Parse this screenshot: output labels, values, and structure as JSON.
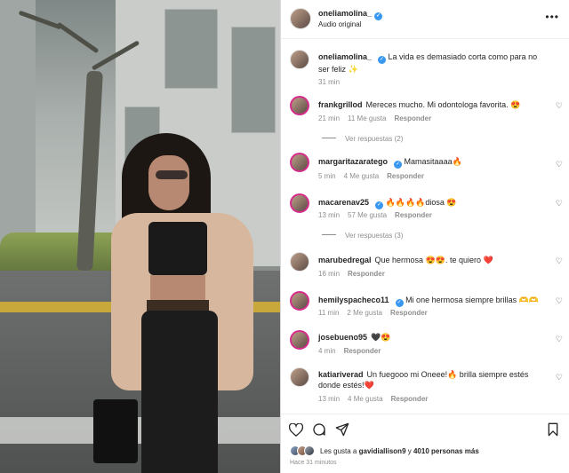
{
  "header": {
    "username": "oneliamolina_",
    "subtitle": "Audio original"
  },
  "caption": {
    "username": "oneliamolina_",
    "text": "La vida es demasiado corta como para no ser feliz ✨",
    "time": "31 min"
  },
  "comments": [
    {
      "username": "frankgrillod",
      "text": "Mereces mucho. Mi odontologa favorita. 😍",
      "time": "21 min",
      "likes": "11 Me gusta",
      "reply": "Responder",
      "view_replies": "Ver respuestas (2)"
    },
    {
      "username": "margaritazaratego",
      "text": "Mamasitaaaa🔥",
      "time": "5 min",
      "likes": "4 Me gusta",
      "reply": "Responder"
    },
    {
      "username": "macarenav25",
      "text": "🔥🔥🔥🔥diosa 😍",
      "time": "13 min",
      "likes": "57 Me gusta",
      "reply": "Responder",
      "view_replies": "Ver respuestas (3)"
    },
    {
      "username": "marubedregal",
      "text": "Que hermosa 😍😍. te quiero ❤️",
      "time": "16 min",
      "reply": "Responder"
    },
    {
      "username": "hemilyspacheco11",
      "text": "Mi one hermosa siempre brillas 🫶🫶",
      "time": "11 min",
      "likes": "2 Me gusta",
      "reply": "Responder"
    },
    {
      "username": "josebueno95",
      "text": "🖤😍",
      "time": "4 min",
      "reply": "Responder"
    },
    {
      "username": "katiariverad",
      "text": "Un fuegooo mi Oneee!🔥 brilla siempre estés donde estés!❤️",
      "time": "13 min",
      "likes": "4 Me gusta",
      "reply": "Responder"
    }
  ],
  "actions": {
    "likes_prefix": "Les gusta a",
    "liked_by": "gavidiallison9",
    "joiner": "y",
    "others": "4010 personas más",
    "posted_ago": "Hace 31 minutos"
  },
  "icons": [
    "more-icon",
    "heart-icon",
    "comment-icon",
    "share-icon",
    "bookmark-icon",
    "verified-icon"
  ],
  "colors": {
    "verified": "#3897f0",
    "story_ring": "#d52c8c",
    "secondary_text": "#8e8e8e"
  }
}
